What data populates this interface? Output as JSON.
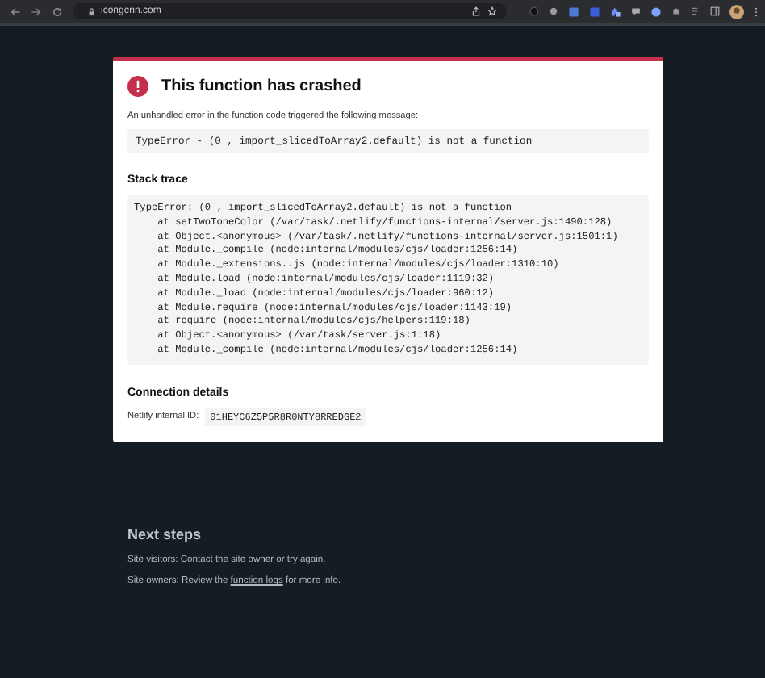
{
  "browser": {
    "url": "icongenn.com"
  },
  "error_card": {
    "title": "This function has crashed",
    "intro": "An unhandled error in the function code triggered the following message:",
    "message": "TypeError - (0 , import_slicedToArray2.default) is not a function",
    "stack_heading": "Stack trace",
    "stack_lines": [
      "TypeError: (0 , import_slicedToArray2.default) is not a function",
      "    at setTwoToneColor (/var/task/.netlify/functions-internal/server.js:1490:128)",
      "    at Object.<anonymous> (/var/task/.netlify/functions-internal/server.js:1501:1)",
      "    at Module._compile (node:internal/modules/cjs/loader:1256:14)",
      "    at Module._extensions..js (node:internal/modules/cjs/loader:1310:10)",
      "    at Module.load (node:internal/modules/cjs/loader:1119:32)",
      "    at Module._load (node:internal/modules/cjs/loader:960:12)",
      "    at Module.require (node:internal/modules/cjs/loader:1143:19)",
      "    at require (node:internal/modules/cjs/helpers:119:18)",
      "    at Object.<anonymous> (/var/task/server.js:1:18)",
      "    at Module._compile (node:internal/modules/cjs/loader:1256:14)"
    ],
    "connection_heading": "Connection details",
    "id_label": "Netlify internal ID:",
    "id_value": "01HEYC6Z5P5R8R0NTY8RREDGE2"
  },
  "next_steps": {
    "heading": "Next steps",
    "visitors": "Site visitors: Contact the site owner or try again.",
    "owners_prefix": "Site owners: Review the",
    "owners_link": "function logs",
    "owners_suffix": "for more info."
  }
}
